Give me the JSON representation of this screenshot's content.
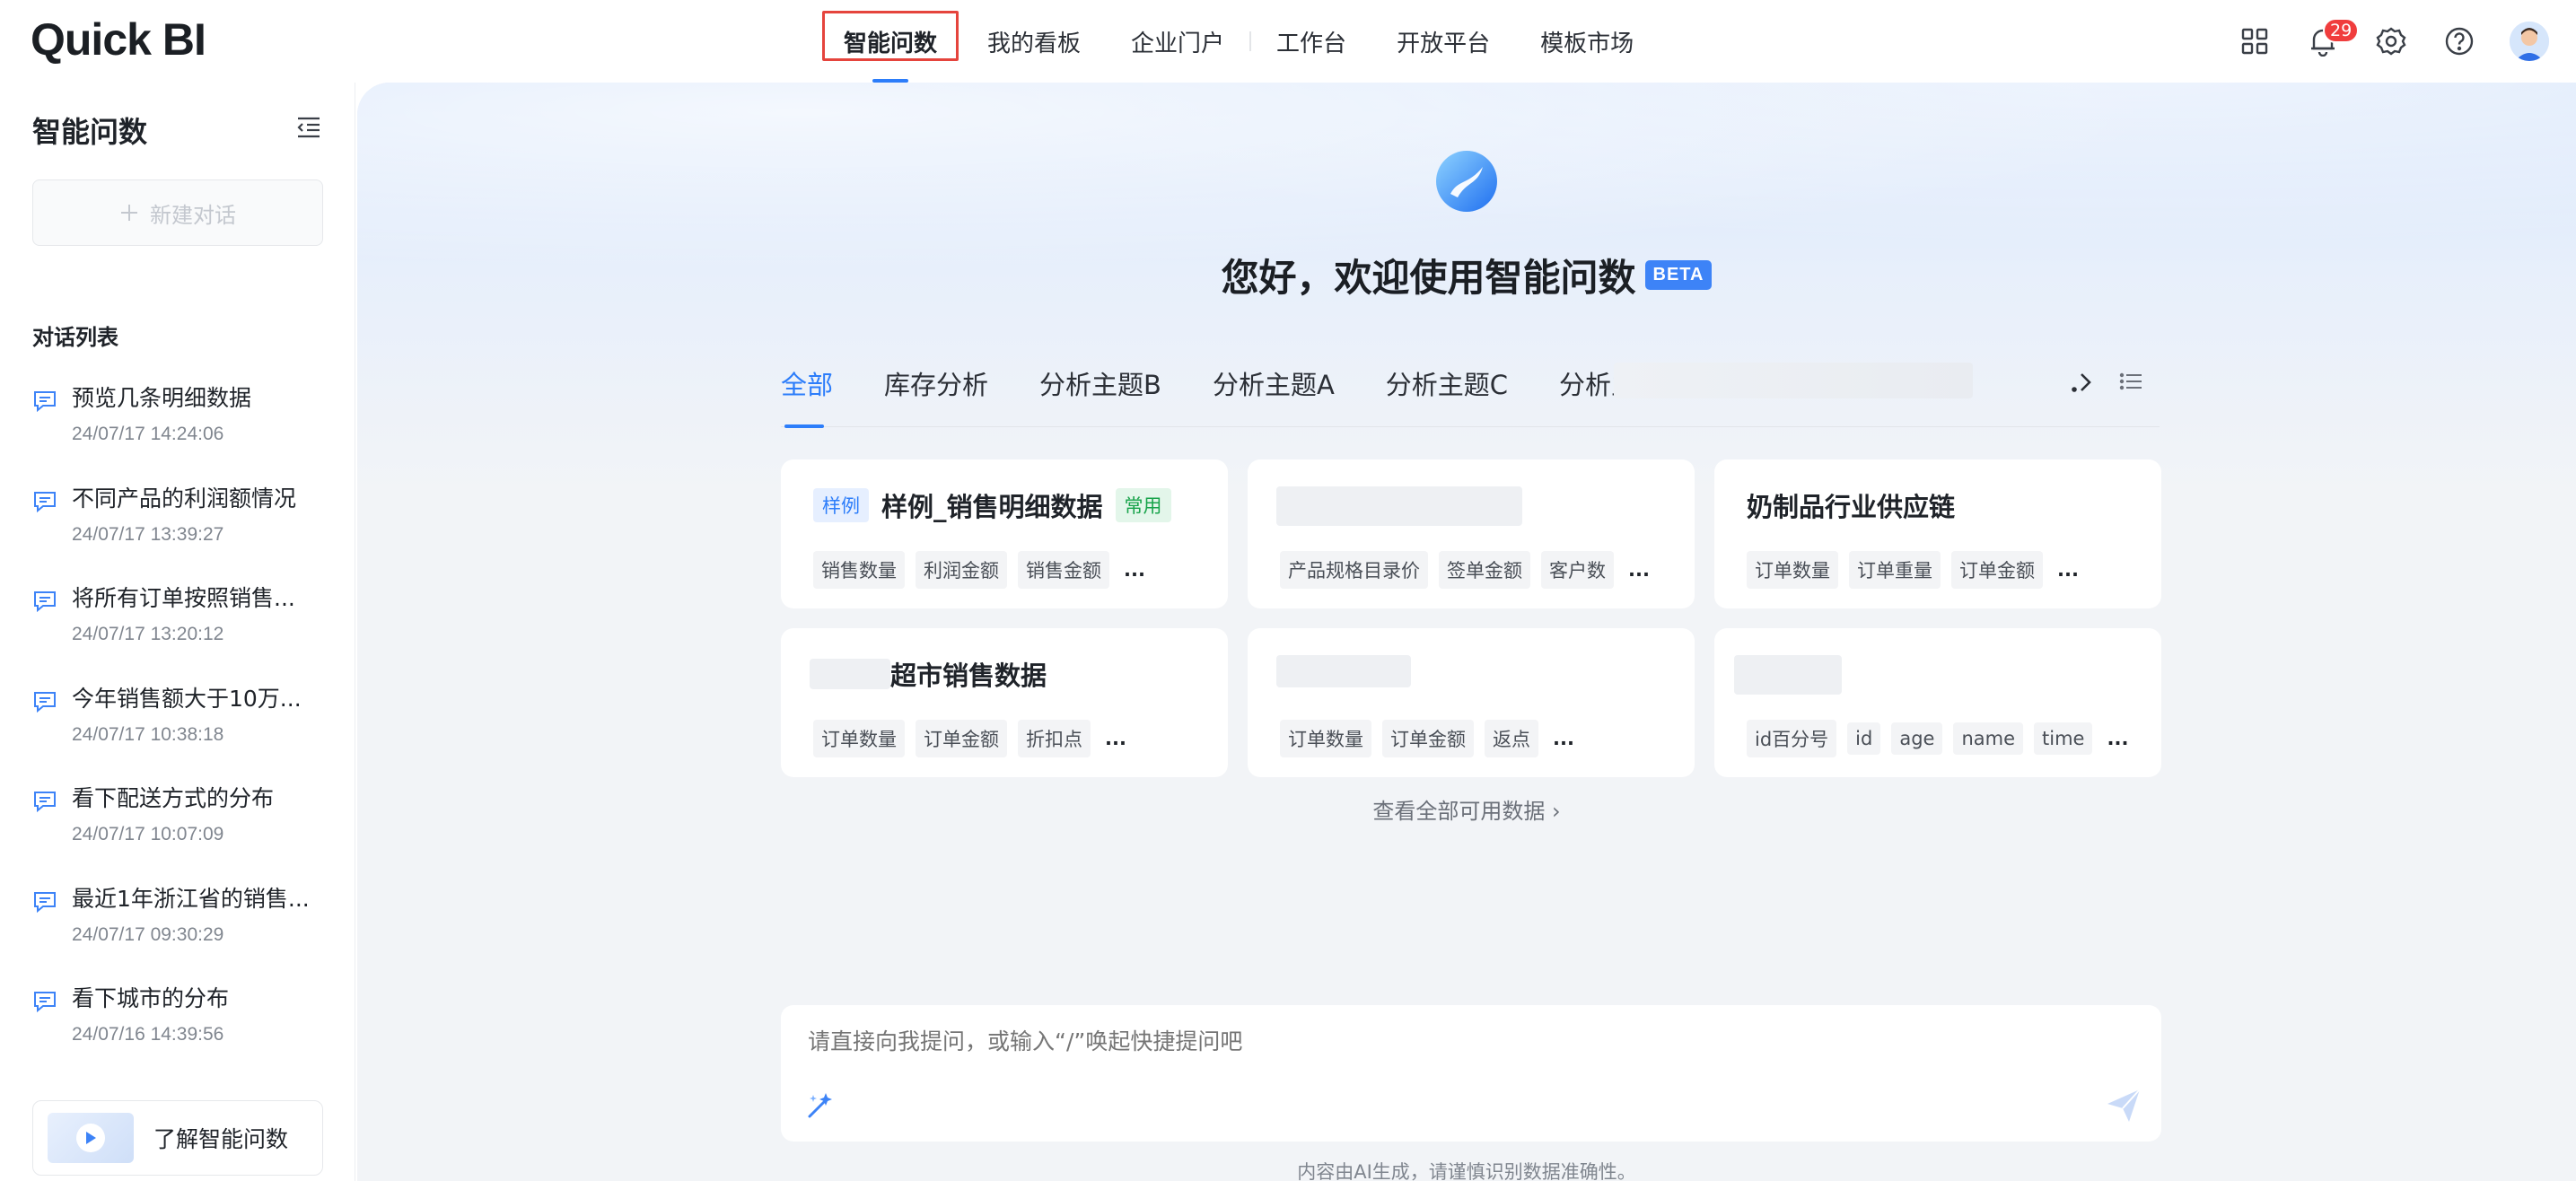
{
  "app": {
    "logo": "Quick BI"
  },
  "topnav": {
    "items": [
      {
        "label": "智能问数",
        "active": true
      },
      {
        "label": "我的看板"
      },
      {
        "label": "企业门户"
      },
      {
        "label": "工作台"
      },
      {
        "label": "开放平台"
      },
      {
        "label": "模板市场"
      }
    ],
    "notifications_count": "29",
    "icons": [
      "apps-grid-icon",
      "bell-icon",
      "gear-icon",
      "help-icon",
      "avatar"
    ]
  },
  "sidebar": {
    "title": "智能问数",
    "new_chat": "新建对话",
    "list_title": "对话列表",
    "conversations": [
      {
        "title": "预览几条明细数据",
        "time": "24/07/17 14:24:06"
      },
      {
        "title": "不同产品的利润额情况",
        "time": "24/07/17 13:39:27"
      },
      {
        "title": "将所有订单按照销售...",
        "time": "24/07/17 13:20:12"
      },
      {
        "title": "今年销售额大于10万...",
        "time": "24/07/17 10:38:18"
      },
      {
        "title": "看下配送方式的分布",
        "time": "24/07/17 10:07:09"
      },
      {
        "title": "最近1年浙江省的销售...",
        "time": "24/07/17 09:30:29"
      },
      {
        "title": "看下城市的分布",
        "time": "24/07/16 14:39:56"
      }
    ],
    "learn": "了解智能问数"
  },
  "main": {
    "greeting": "您好，欢迎使用智能问数",
    "beta": "BETA",
    "tabs": [
      "全部",
      "库存分析",
      "分析主题B",
      "分析主题A",
      "分析主题C",
      "分析主题D"
    ],
    "cards": [
      {
        "tag": "样例",
        "title": "样例_销售明细数据",
        "badge": "常用",
        "fields": [
          "销售数量",
          "利润金额",
          "销售金额"
        ],
        "more": "..."
      },
      {
        "title": "",
        "fields": [
          "产品规格目录价",
          "签单金额",
          "客户数"
        ],
        "more": "..."
      },
      {
        "title": "奶制品行业供应链",
        "fields": [
          "订单数量",
          "订单重量",
          "订单金额"
        ],
        "more": "..."
      },
      {
        "title": "超市销售数据",
        "fields": [
          "订单数量",
          "订单金额",
          "折扣点"
        ],
        "more": "..."
      },
      {
        "title": "",
        "fields": [
          "订单数量",
          "订单金额",
          "返点"
        ],
        "more": "..."
      },
      {
        "title": "",
        "fields": [
          "id百分号",
          "id",
          "age",
          "name",
          "time"
        ],
        "more": "..."
      }
    ],
    "see_all": "查看全部可用数据 ›",
    "input_placeholder": "请直接向我提问，或输入“/”唤起快捷提问吧",
    "disclaimer": "内容由AI生成，请谨慎识别数据准确性。"
  },
  "colors": {
    "accent": "#2c7dfa",
    "highlight_box": "#e5443d",
    "badge": "#f03d3d",
    "common_tag": "#17a34a"
  }
}
